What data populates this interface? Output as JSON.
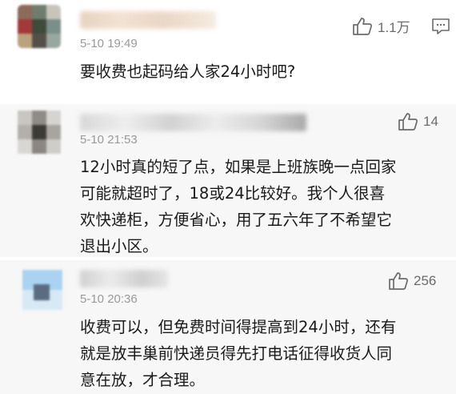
{
  "comments": [
    {
      "time": "5-10 19:49",
      "likes": "1.1万",
      "lines": [
        "要收费也起码给人家24小时吧?"
      ]
    },
    {
      "time": "5-10 21:53",
      "likes": "14",
      "lines": [
        "12小时真的短了点，如果是上班族晚一点回家",
        "可能就超时了，18或24比较好。我个人很喜",
        "欢快递柜，方便省心，用了五六年了不希望它",
        "退出小区。"
      ]
    },
    {
      "time": "5-10 20:36",
      "likes": "256",
      "lines": [
        "收费可以，但免费时间得提高到24小时，还有",
        "就是放丰巢前快递员得先打电话征得收货人同",
        "意在放，才合理。"
      ]
    }
  ],
  "icons": {
    "like": "thumbs-up-icon",
    "reply": "comment-icon"
  },
  "colors": {
    "text": "#1a1a1a",
    "meta": "#9a9a9a",
    "icon": "#6b6b6b",
    "alt_background": "#f7f7f7"
  }
}
